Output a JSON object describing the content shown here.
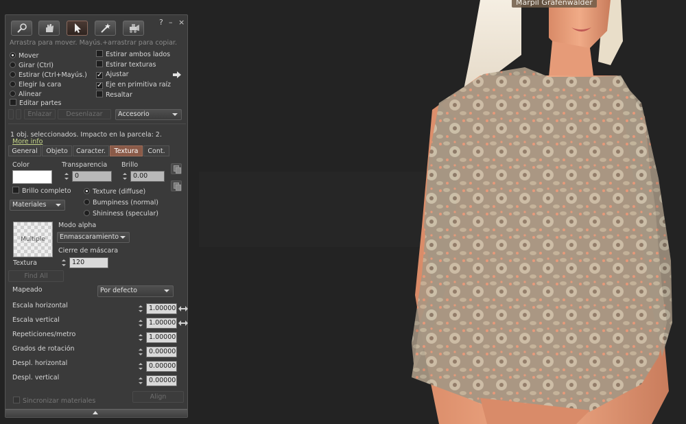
{
  "scene": {
    "avatar_name": "Marpil Grafenwalder"
  },
  "panel": {
    "header": {
      "help": "?",
      "minimize": "–",
      "close": "×"
    },
    "tools": [
      "focus-tool",
      "move-tool",
      "edit-tool",
      "create-tool",
      "land-tool"
    ],
    "hint": "Arrastra para mover. Mayús.+arrastrar para copiar.",
    "modes": [
      {
        "label": "Mover",
        "selected": true
      },
      {
        "label": "Girar (Ctrl)",
        "selected": false
      },
      {
        "label": "Estirar (Ctrl+Mayús.)",
        "selected": false
      },
      {
        "label": "Elegir la cara",
        "selected": false
      },
      {
        "label": "Alinear",
        "selected": false
      }
    ],
    "edit_parts": {
      "label": "Editar partes",
      "checked": false
    },
    "options": [
      {
        "label": "Estirar ambos lados",
        "checked": false
      },
      {
        "label": "Estirar texturas",
        "checked": false
      },
      {
        "label": "Ajustar",
        "checked": true
      },
      {
        "label": "Eje en primitiva raíz",
        "checked": true
      },
      {
        "label": "Resaltar",
        "checked": false
      }
    ],
    "link_label": "Enlazar",
    "unlink_label": "Desenlazar",
    "attach_combo": "Accesorio",
    "selection_info": "1 obj. seleccionados. Impacto en la parcela: 2.",
    "more_info": "More info",
    "tabs": [
      {
        "label": "General",
        "active": false
      },
      {
        "label": "Objeto",
        "active": false
      },
      {
        "label": "Caracter.",
        "active": false
      },
      {
        "label": "Textura",
        "active": true
      },
      {
        "label": "Cont.",
        "active": false
      }
    ],
    "texture": {
      "color_label": "Color",
      "color_value": "#ffffff",
      "transparency_label": "Transparencia",
      "transparency_value": "0",
      "glow_label": "Brillo",
      "glow_value": "0.00",
      "fullbright_label": "Brillo completo",
      "materials_combo": "Materiales",
      "map_options": [
        {
          "label": "Texture (diffuse)",
          "selected": true
        },
        {
          "label": "Bumpiness (normal)",
          "selected": false
        },
        {
          "label": "Shininess (specular)",
          "selected": false
        }
      ],
      "thumb_text": "Multiple",
      "thumb_label": "Textura",
      "alpha_mode_label": "Modo alpha",
      "alpha_mode_value": "Enmascaramiento",
      "mask_cutoff_label": "Cierre de máscara",
      "mask_cutoff_value": "120",
      "find_all": "Find All",
      "mapping_label": "Mapeado",
      "mapping_value": "Por defecto",
      "params": [
        {
          "label": "Escala horizontal",
          "value": "1.00000",
          "link": true
        },
        {
          "label": "Escala vertical",
          "value": "1.00000",
          "link": true
        },
        {
          "label": "Repeticiones/metro",
          "value": "1.00000",
          "link": false
        },
        {
          "label": "Grados de rotación",
          "value": "0.00000",
          "link": false
        },
        {
          "label": "Despl. horizontal",
          "value": "0.00000",
          "link": false
        },
        {
          "label": "Despl. vertical",
          "value": "0.00000",
          "link": false
        }
      ],
      "sync_materials": "Sincronizar materiales",
      "align_button": "Align"
    }
  },
  "colors": {
    "tab_active": "#8a5a48",
    "link_text": "#c9d98c",
    "skin": "#e59a78",
    "lace": "#b9ab95",
    "hair": "#efe6d6"
  }
}
